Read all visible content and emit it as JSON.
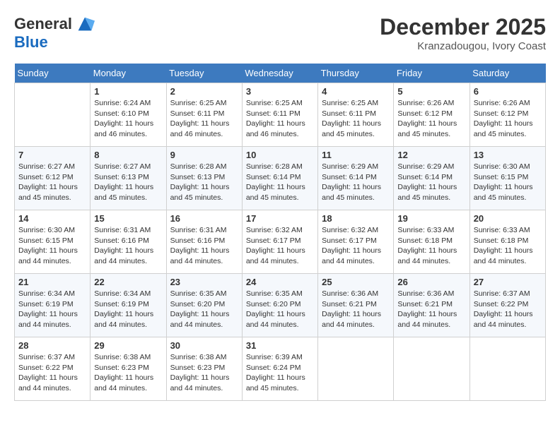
{
  "header": {
    "logo_general": "General",
    "logo_blue": "Blue",
    "month_title": "December 2025",
    "location": "Kranzadougou, Ivory Coast"
  },
  "days_of_week": [
    "Sunday",
    "Monday",
    "Tuesday",
    "Wednesday",
    "Thursday",
    "Friday",
    "Saturday"
  ],
  "weeks": [
    [
      {
        "day": "",
        "info": ""
      },
      {
        "day": "1",
        "info": "Sunrise: 6:24 AM\nSunset: 6:10 PM\nDaylight: 11 hours\nand 46 minutes."
      },
      {
        "day": "2",
        "info": "Sunrise: 6:25 AM\nSunset: 6:11 PM\nDaylight: 11 hours\nand 46 minutes."
      },
      {
        "day": "3",
        "info": "Sunrise: 6:25 AM\nSunset: 6:11 PM\nDaylight: 11 hours\nand 46 minutes."
      },
      {
        "day": "4",
        "info": "Sunrise: 6:25 AM\nSunset: 6:11 PM\nDaylight: 11 hours\nand 45 minutes."
      },
      {
        "day": "5",
        "info": "Sunrise: 6:26 AM\nSunset: 6:12 PM\nDaylight: 11 hours\nand 45 minutes."
      },
      {
        "day": "6",
        "info": "Sunrise: 6:26 AM\nSunset: 6:12 PM\nDaylight: 11 hours\nand 45 minutes."
      }
    ],
    [
      {
        "day": "7",
        "info": "Sunrise: 6:27 AM\nSunset: 6:12 PM\nDaylight: 11 hours\nand 45 minutes."
      },
      {
        "day": "8",
        "info": "Sunrise: 6:27 AM\nSunset: 6:13 PM\nDaylight: 11 hours\nand 45 minutes."
      },
      {
        "day": "9",
        "info": "Sunrise: 6:28 AM\nSunset: 6:13 PM\nDaylight: 11 hours\nand 45 minutes."
      },
      {
        "day": "10",
        "info": "Sunrise: 6:28 AM\nSunset: 6:14 PM\nDaylight: 11 hours\nand 45 minutes."
      },
      {
        "day": "11",
        "info": "Sunrise: 6:29 AM\nSunset: 6:14 PM\nDaylight: 11 hours\nand 45 minutes."
      },
      {
        "day": "12",
        "info": "Sunrise: 6:29 AM\nSunset: 6:14 PM\nDaylight: 11 hours\nand 45 minutes."
      },
      {
        "day": "13",
        "info": "Sunrise: 6:30 AM\nSunset: 6:15 PM\nDaylight: 11 hours\nand 45 minutes."
      }
    ],
    [
      {
        "day": "14",
        "info": "Sunrise: 6:30 AM\nSunset: 6:15 PM\nDaylight: 11 hours\nand 44 minutes."
      },
      {
        "day": "15",
        "info": "Sunrise: 6:31 AM\nSunset: 6:16 PM\nDaylight: 11 hours\nand 44 minutes."
      },
      {
        "day": "16",
        "info": "Sunrise: 6:31 AM\nSunset: 6:16 PM\nDaylight: 11 hours\nand 44 minutes."
      },
      {
        "day": "17",
        "info": "Sunrise: 6:32 AM\nSunset: 6:17 PM\nDaylight: 11 hours\nand 44 minutes."
      },
      {
        "day": "18",
        "info": "Sunrise: 6:32 AM\nSunset: 6:17 PM\nDaylight: 11 hours\nand 44 minutes."
      },
      {
        "day": "19",
        "info": "Sunrise: 6:33 AM\nSunset: 6:18 PM\nDaylight: 11 hours\nand 44 minutes."
      },
      {
        "day": "20",
        "info": "Sunrise: 6:33 AM\nSunset: 6:18 PM\nDaylight: 11 hours\nand 44 minutes."
      }
    ],
    [
      {
        "day": "21",
        "info": "Sunrise: 6:34 AM\nSunset: 6:19 PM\nDaylight: 11 hours\nand 44 minutes."
      },
      {
        "day": "22",
        "info": "Sunrise: 6:34 AM\nSunset: 6:19 PM\nDaylight: 11 hours\nand 44 minutes."
      },
      {
        "day": "23",
        "info": "Sunrise: 6:35 AM\nSunset: 6:20 PM\nDaylight: 11 hours\nand 44 minutes."
      },
      {
        "day": "24",
        "info": "Sunrise: 6:35 AM\nSunset: 6:20 PM\nDaylight: 11 hours\nand 44 minutes."
      },
      {
        "day": "25",
        "info": "Sunrise: 6:36 AM\nSunset: 6:21 PM\nDaylight: 11 hours\nand 44 minutes."
      },
      {
        "day": "26",
        "info": "Sunrise: 6:36 AM\nSunset: 6:21 PM\nDaylight: 11 hours\nand 44 minutes."
      },
      {
        "day": "27",
        "info": "Sunrise: 6:37 AM\nSunset: 6:22 PM\nDaylight: 11 hours\nand 44 minutes."
      }
    ],
    [
      {
        "day": "28",
        "info": "Sunrise: 6:37 AM\nSunset: 6:22 PM\nDaylight: 11 hours\nand 44 minutes."
      },
      {
        "day": "29",
        "info": "Sunrise: 6:38 AM\nSunset: 6:23 PM\nDaylight: 11 hours\nand 44 minutes."
      },
      {
        "day": "30",
        "info": "Sunrise: 6:38 AM\nSunset: 6:23 PM\nDaylight: 11 hours\nand 44 minutes."
      },
      {
        "day": "31",
        "info": "Sunrise: 6:39 AM\nSunset: 6:24 PM\nDaylight: 11 hours\nand 45 minutes."
      },
      {
        "day": "",
        "info": ""
      },
      {
        "day": "",
        "info": ""
      },
      {
        "day": "",
        "info": ""
      }
    ]
  ]
}
